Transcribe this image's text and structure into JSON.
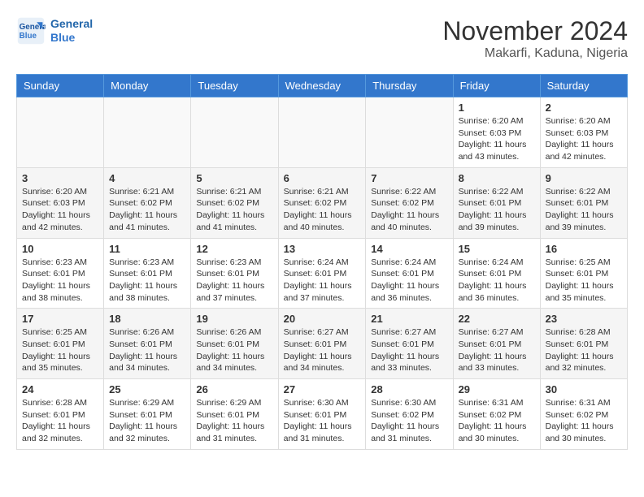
{
  "header": {
    "logo_line1": "General",
    "logo_line2": "Blue",
    "month": "November 2024",
    "location": "Makarfi, Kaduna, Nigeria"
  },
  "weekdays": [
    "Sunday",
    "Monday",
    "Tuesday",
    "Wednesday",
    "Thursday",
    "Friday",
    "Saturday"
  ],
  "weeks": [
    [
      {
        "day": "",
        "info": ""
      },
      {
        "day": "",
        "info": ""
      },
      {
        "day": "",
        "info": ""
      },
      {
        "day": "",
        "info": ""
      },
      {
        "day": "",
        "info": ""
      },
      {
        "day": "1",
        "info": "Sunrise: 6:20 AM\nSunset: 6:03 PM\nDaylight: 11 hours and 43 minutes."
      },
      {
        "day": "2",
        "info": "Sunrise: 6:20 AM\nSunset: 6:03 PM\nDaylight: 11 hours and 42 minutes."
      }
    ],
    [
      {
        "day": "3",
        "info": "Sunrise: 6:20 AM\nSunset: 6:03 PM\nDaylight: 11 hours and 42 minutes."
      },
      {
        "day": "4",
        "info": "Sunrise: 6:21 AM\nSunset: 6:02 PM\nDaylight: 11 hours and 41 minutes."
      },
      {
        "day": "5",
        "info": "Sunrise: 6:21 AM\nSunset: 6:02 PM\nDaylight: 11 hours and 41 minutes."
      },
      {
        "day": "6",
        "info": "Sunrise: 6:21 AM\nSunset: 6:02 PM\nDaylight: 11 hours and 40 minutes."
      },
      {
        "day": "7",
        "info": "Sunrise: 6:22 AM\nSunset: 6:02 PM\nDaylight: 11 hours and 40 minutes."
      },
      {
        "day": "8",
        "info": "Sunrise: 6:22 AM\nSunset: 6:01 PM\nDaylight: 11 hours and 39 minutes."
      },
      {
        "day": "9",
        "info": "Sunrise: 6:22 AM\nSunset: 6:01 PM\nDaylight: 11 hours and 39 minutes."
      }
    ],
    [
      {
        "day": "10",
        "info": "Sunrise: 6:23 AM\nSunset: 6:01 PM\nDaylight: 11 hours and 38 minutes."
      },
      {
        "day": "11",
        "info": "Sunrise: 6:23 AM\nSunset: 6:01 PM\nDaylight: 11 hours and 38 minutes."
      },
      {
        "day": "12",
        "info": "Sunrise: 6:23 AM\nSunset: 6:01 PM\nDaylight: 11 hours and 37 minutes."
      },
      {
        "day": "13",
        "info": "Sunrise: 6:24 AM\nSunset: 6:01 PM\nDaylight: 11 hours and 37 minutes."
      },
      {
        "day": "14",
        "info": "Sunrise: 6:24 AM\nSunset: 6:01 PM\nDaylight: 11 hours and 36 minutes."
      },
      {
        "day": "15",
        "info": "Sunrise: 6:24 AM\nSunset: 6:01 PM\nDaylight: 11 hours and 36 minutes."
      },
      {
        "day": "16",
        "info": "Sunrise: 6:25 AM\nSunset: 6:01 PM\nDaylight: 11 hours and 35 minutes."
      }
    ],
    [
      {
        "day": "17",
        "info": "Sunrise: 6:25 AM\nSunset: 6:01 PM\nDaylight: 11 hours and 35 minutes."
      },
      {
        "day": "18",
        "info": "Sunrise: 6:26 AM\nSunset: 6:01 PM\nDaylight: 11 hours and 34 minutes."
      },
      {
        "day": "19",
        "info": "Sunrise: 6:26 AM\nSunset: 6:01 PM\nDaylight: 11 hours and 34 minutes."
      },
      {
        "day": "20",
        "info": "Sunrise: 6:27 AM\nSunset: 6:01 PM\nDaylight: 11 hours and 34 minutes."
      },
      {
        "day": "21",
        "info": "Sunrise: 6:27 AM\nSunset: 6:01 PM\nDaylight: 11 hours and 33 minutes."
      },
      {
        "day": "22",
        "info": "Sunrise: 6:27 AM\nSunset: 6:01 PM\nDaylight: 11 hours and 33 minutes."
      },
      {
        "day": "23",
        "info": "Sunrise: 6:28 AM\nSunset: 6:01 PM\nDaylight: 11 hours and 32 minutes."
      }
    ],
    [
      {
        "day": "24",
        "info": "Sunrise: 6:28 AM\nSunset: 6:01 PM\nDaylight: 11 hours and 32 minutes."
      },
      {
        "day": "25",
        "info": "Sunrise: 6:29 AM\nSunset: 6:01 PM\nDaylight: 11 hours and 32 minutes."
      },
      {
        "day": "26",
        "info": "Sunrise: 6:29 AM\nSunset: 6:01 PM\nDaylight: 11 hours and 31 minutes."
      },
      {
        "day": "27",
        "info": "Sunrise: 6:30 AM\nSunset: 6:01 PM\nDaylight: 11 hours and 31 minutes."
      },
      {
        "day": "28",
        "info": "Sunrise: 6:30 AM\nSunset: 6:02 PM\nDaylight: 11 hours and 31 minutes."
      },
      {
        "day": "29",
        "info": "Sunrise: 6:31 AM\nSunset: 6:02 PM\nDaylight: 11 hours and 30 minutes."
      },
      {
        "day": "30",
        "info": "Sunrise: 6:31 AM\nSunset: 6:02 PM\nDaylight: 11 hours and 30 minutes."
      }
    ]
  ]
}
